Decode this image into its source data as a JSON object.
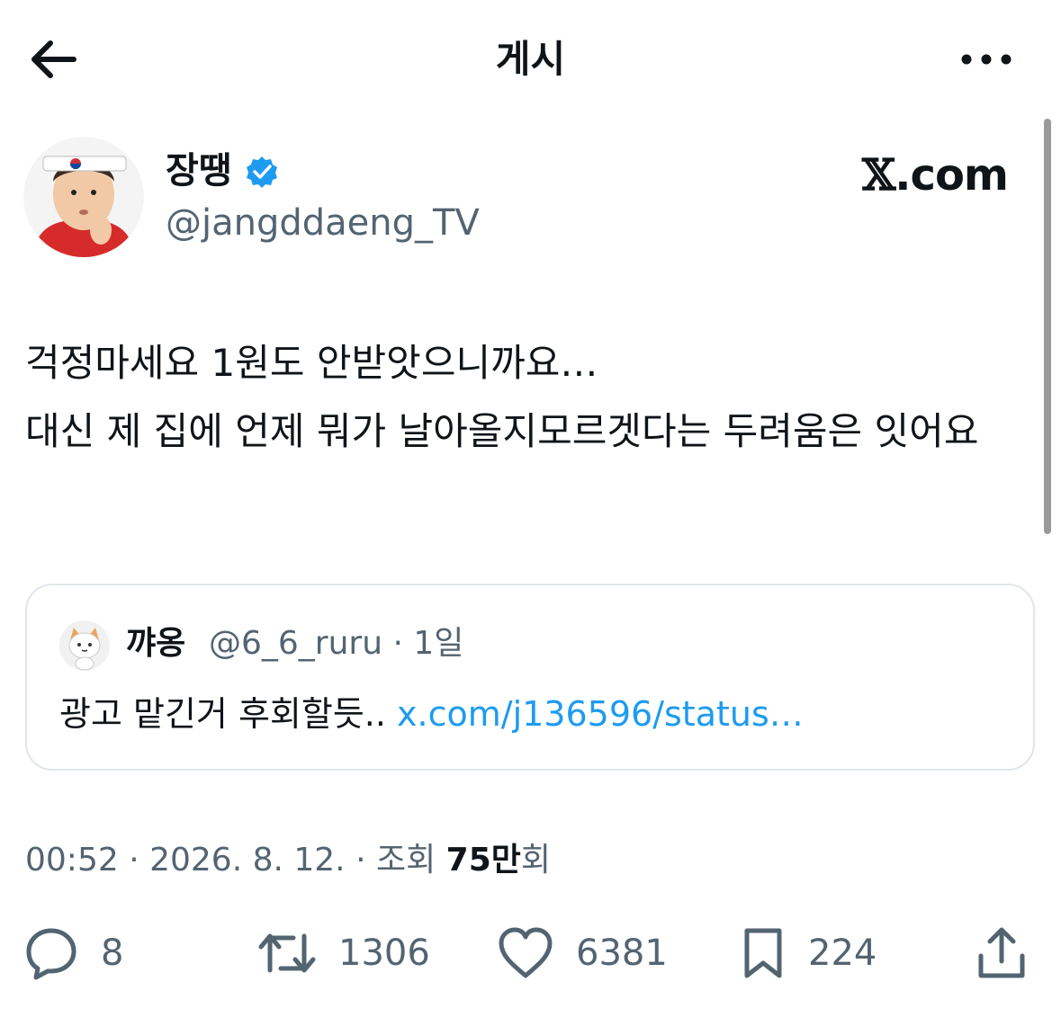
{
  "header": {
    "title": "게시",
    "back_icon": "arrow-left-icon",
    "more_icon": "more-horizontal-icon"
  },
  "author": {
    "name": "장땡",
    "handle": "@jangddaeng_TV",
    "verified_icon": "verified-badge-icon",
    "verified_color": "#1d9bf0"
  },
  "branding": {
    "x_mark": "𝕏",
    "domain": ".com"
  },
  "tweet": {
    "text": "걱정마세요 1원도 안받앗으니까요…\n대신 제 집에 언제 뭐가 날아올지모르겟다는 두려움은 잇어요"
  },
  "quote": {
    "name": "꺄옹",
    "handle_time": "@6_6_ruru · 1일",
    "text": "광고 맡긴거 후회할듯.. ",
    "link": "x.com/j136596/status…",
    "link_color": "#1d9bf0"
  },
  "meta": {
    "time_date": "00:52 · 2026. 8. 12. · 조회 ",
    "views_number": "75만",
    "views_suffix": "회"
  },
  "actions": {
    "reply": {
      "icon": "reply-icon",
      "count": "8"
    },
    "retweet": {
      "icon": "retweet-icon",
      "count": "1306"
    },
    "like": {
      "icon": "heart-icon",
      "count": "6381"
    },
    "bookmark": {
      "icon": "bookmark-icon",
      "count": "224"
    },
    "share": {
      "icon": "share-icon"
    }
  },
  "colors": {
    "text_primary": "#0f1419",
    "text_secondary": "#536471",
    "border": "#e1e6ea"
  }
}
